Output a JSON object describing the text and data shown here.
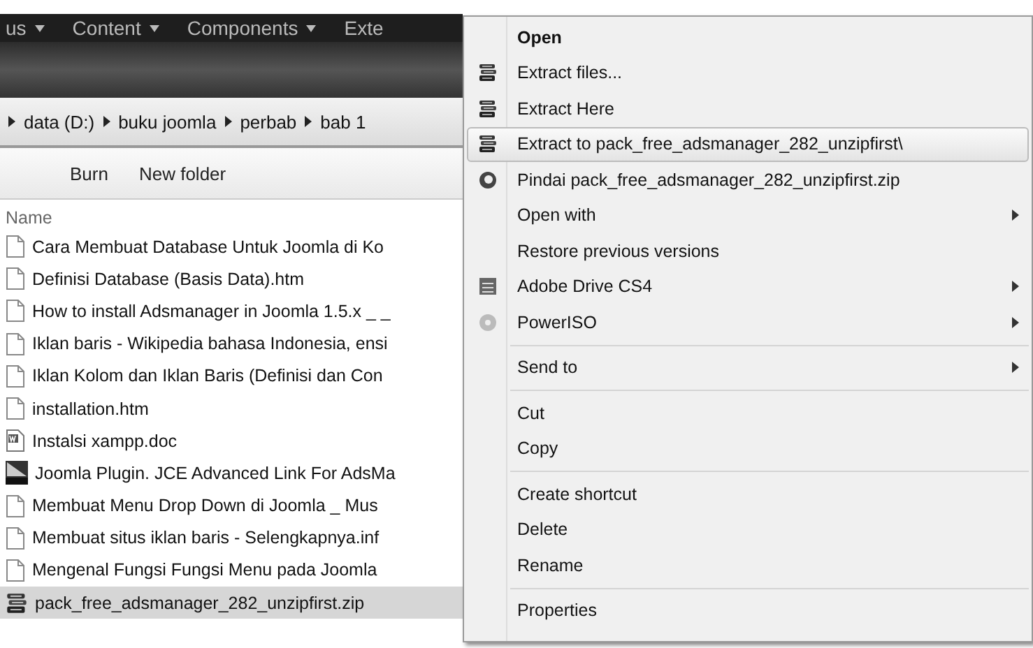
{
  "top_menu": [
    {
      "label": "us",
      "dropdown": true
    },
    {
      "label": "Content",
      "dropdown": true
    },
    {
      "label": "Components",
      "dropdown": true
    },
    {
      "label": "Exte",
      "dropdown": false
    }
  ],
  "breadcrumb": [
    "data (D:)",
    "buku joomla",
    "perbab",
    "bab 1"
  ],
  "toolbar": [
    "Burn",
    "New folder"
  ],
  "file_list": {
    "column": "Name",
    "files": [
      {
        "name": "Cara Membuat Database Untuk Joomla di Ko",
        "kind": "page",
        "selected": false
      },
      {
        "name": "Definisi Database (Basis Data).htm",
        "kind": "page",
        "selected": false
      },
      {
        "name": "How to install Adsmanager in Joomla 1.5.x _ _",
        "kind": "page",
        "selected": false
      },
      {
        "name": "Iklan baris - Wikipedia bahasa Indonesia, ensi",
        "kind": "page",
        "selected": false
      },
      {
        "name": "Iklan Kolom dan Iklan Baris (Definisi dan Con",
        "kind": "page",
        "selected": false
      },
      {
        "name": "installation.htm",
        "kind": "page",
        "selected": false
      },
      {
        "name": "Instalsi xampp.doc",
        "kind": "word",
        "selected": false
      },
      {
        "name": "Joomla Plugin. JCE Advanced Link For AdsMa",
        "kind": "video",
        "selected": false
      },
      {
        "name": "Membuat Menu Drop Down di Joomla _ Mus",
        "kind": "page",
        "selected": false
      },
      {
        "name": "Membuat situs iklan baris - Selengkapnya.inf",
        "kind": "page",
        "selected": false
      },
      {
        "name": "Mengenal Fungsi Fungsi Menu pada Joomla",
        "kind": "page",
        "selected": false
      },
      {
        "name": "pack_free_adsmanager_282_unzipfirst.zip",
        "kind": "archive",
        "selected": true
      }
    ]
  },
  "context_menu": [
    {
      "kind": "item",
      "label": "Open",
      "bold": true,
      "selected": false,
      "submenu": false
    },
    {
      "kind": "archive",
      "label": "Extract files...",
      "selected": false,
      "submenu": false
    },
    {
      "kind": "archive",
      "label": "Extract Here",
      "selected": false,
      "submenu": false
    },
    {
      "kind": "archive",
      "label": "Extract to pack_free_adsmanager_282_unzipfirst\\",
      "selected": true,
      "submenu": false
    },
    {
      "kind": "scan",
      "label": "Pindai pack_free_adsmanager_282_unzipfirst.zip",
      "selected": false,
      "submenu": false
    },
    {
      "kind": "item",
      "label": "Open with",
      "selected": false,
      "submenu": true
    },
    {
      "kind": "item",
      "label": "Restore previous versions",
      "selected": false,
      "submenu": false
    },
    {
      "kind": "drive",
      "label": "Adobe Drive CS4",
      "selected": false,
      "submenu": true
    },
    {
      "kind": "disc",
      "label": "PowerISO",
      "selected": false,
      "submenu": true
    },
    {
      "kind": "separator"
    },
    {
      "kind": "item",
      "label": "Send to",
      "selected": false,
      "submenu": true
    },
    {
      "kind": "separator"
    },
    {
      "kind": "item",
      "label": "Cut",
      "selected": false,
      "submenu": false
    },
    {
      "kind": "item",
      "label": "Copy",
      "selected": false,
      "submenu": false
    },
    {
      "kind": "separator"
    },
    {
      "kind": "item",
      "label": "Create shortcut",
      "selected": false,
      "submenu": false
    },
    {
      "kind": "item",
      "label": "Delete",
      "selected": false,
      "submenu": false
    },
    {
      "kind": "item",
      "label": "Rename",
      "selected": false,
      "submenu": false
    },
    {
      "kind": "separator"
    },
    {
      "kind": "item",
      "label": "Properties",
      "selected": false,
      "submenu": false
    }
  ]
}
